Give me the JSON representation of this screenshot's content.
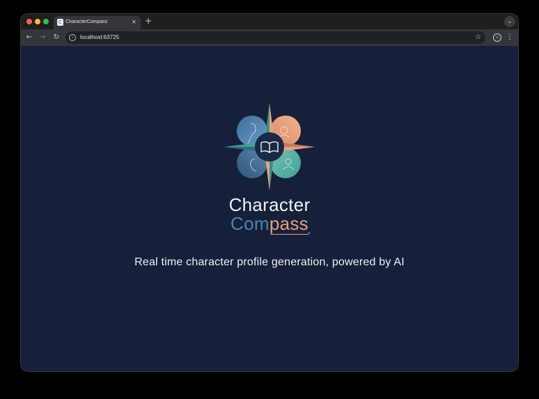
{
  "browser": {
    "tab": {
      "favicon": "C",
      "title": "CharacterCompass",
      "close": "×"
    },
    "new_tab": "+",
    "tab_menu": "⌄",
    "url": "localhost:63725",
    "icons": {
      "back": "←",
      "forward": "→",
      "reload": "↻",
      "site_info": "i",
      "star": "☆",
      "profile": "☺",
      "menu": "⋮"
    }
  },
  "page": {
    "brand_line1": "Character",
    "brand_com": "Com",
    "brand_pass": "pass",
    "tagline": "Real time character profile generation, powered by AI",
    "logo_icon": "compass-book-logo"
  },
  "colors": {
    "page_background": "#16203a",
    "brand_blue": "#4a86ad",
    "brand_peach": "#e3a07a",
    "brand_teal": "#4fb0a6"
  }
}
